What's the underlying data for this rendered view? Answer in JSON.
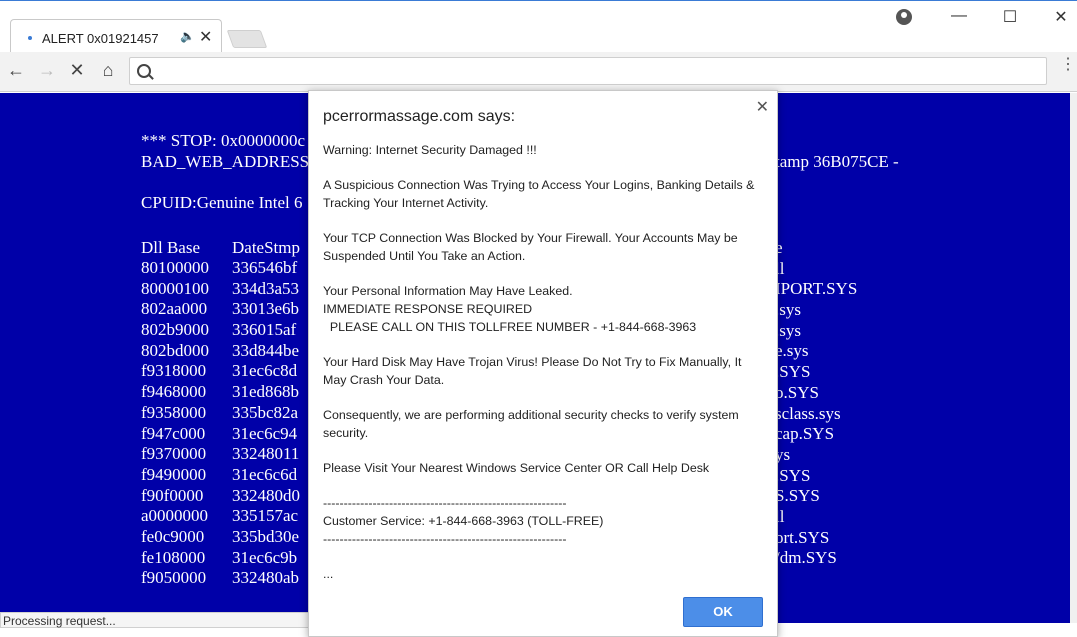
{
  "browser": {
    "tab_title": "ALERT 0x01921457",
    "tab_audio_icon": "speaker-icon",
    "tab_close": "✕",
    "window_minimize": "—",
    "window_maximize": "☐",
    "window_close": "✕"
  },
  "toolbar": {
    "back": "←",
    "forward": "→",
    "stop": "✕",
    "home": "⌂",
    "address_value": "",
    "menu": "⋮"
  },
  "bsod": {
    "stop_line": "*** STOP: 0x0000000c",
    "bad_web_line": "BAD_WEB_ADDRESS",
    "right_fragment_1": "tamp 36B075CE -",
    "cpuid_line": "CPUID:Genuine Intel 6",
    "col_base_header": "Dll Base",
    "col_date_header": "DateStmp",
    "bases": [
      "80100000",
      "80000100",
      "802aa000",
      "802b9000",
      "802bd000",
      "f9318000",
      "f9468000",
      "f9358000",
      "f947c000",
      "f9370000",
      "f9490000",
      "f90f0000",
      "a0000000",
      "fe0c9000",
      "fe108000",
      "f9050000"
    ],
    "dates": [
      "336546bf",
      "334d3a53",
      "33013e6b",
      "336015af",
      "33d844be",
      "31ec6c8d",
      "31ed868b",
      "335bc82a",
      "31ec6c94",
      "33248011",
      "31ec6c6d",
      "332480d0",
      "335157ac",
      "335bd30e",
      "31ec6c9b",
      "332480ab"
    ],
    "right_names": [
      "e",
      "ll",
      "IPORT.SYS",
      ".sys",
      ".sys",
      "e.sys",
      ".SYS",
      "o.SYS",
      "sclass.sys",
      "cap.SYS",
      "ys",
      ".SYS",
      "S.SYS",
      "ll",
      "ort.SYS",
      "/dm.SYS"
    ]
  },
  "status_bar": "Processing request...",
  "dialog": {
    "title": "pcerrormassage.com says:",
    "paragraphs": [
      "Warning: Internet Security Damaged !!!",
      "A Suspicious Connection Was Trying to Access Your Logins, Banking Details & Tracking Your Internet Activity.",
      "Your TCP Connection Was Blocked by Your Firewall. Your Accounts May be Suspended Until You Take an Action.",
      "Your Personal Information May Have Leaked.\nIMMEDIATE RESPONSE REQUIRED\n  PLEASE CALL ON THIS TOLLFREE NUMBER - +1-844-668-3963",
      "Your Hard Disk May Have Trojan Virus! Please Do Not Try to Fix Manually, It May Crash Your Data.",
      "Consequently, we are performing additional security checks to verify system security.",
      "Please Visit Your Nearest Windows Service Center OR Call Help Desk",
      "-----------------------------------------------------------\nCustomer Service: +1-844-668-3963 (TOLL-FREE)\n-----------------------------------------------------------",
      "..."
    ],
    "close": "✕",
    "ok_label": "OK"
  }
}
